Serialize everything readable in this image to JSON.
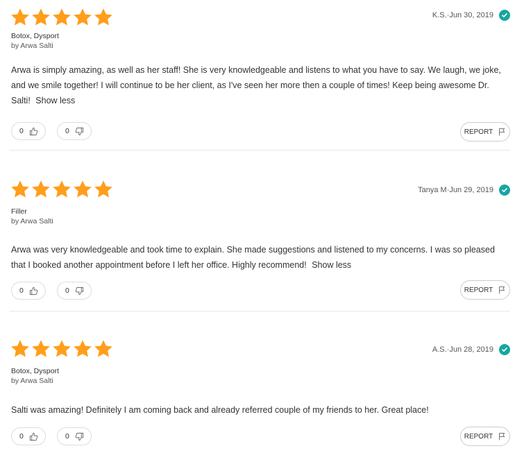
{
  "colors": {
    "star": "#FF9E1B",
    "verified": "#17a6a0",
    "divider": "#e6e6e6"
  },
  "reviews": [
    {
      "rating": 5,
      "author": "K.S.",
      "date": "Jun 30, 2019",
      "treatments": "Botox, Dysport",
      "by": "by Arwa Salti",
      "text": "Arwa is simply amazing, as well as her staff! She is very knowledgeable and listens to what you have to say. We laugh, we joke, and we smile together! I will continue to be her client, as I've seen her more then a couple of times! Keep being awesome Dr. Salti!",
      "show_less": "Show less",
      "helpful": "0",
      "unhelpful": "0",
      "report_label": "REPORT"
    },
    {
      "rating": 5,
      "author": "Tanya M",
      "date": "Jun 29, 2019",
      "treatments": "Filler",
      "by": "by Arwa Salti",
      "text": "Arwa was very knowledgeable and took time to explain. She made suggestions and listened to my concerns. I was so pleased that I booked another appointment before I left her office. Highly recommend!",
      "show_less": "Show less",
      "helpful": "0",
      "unhelpful": "0",
      "report_label": "REPORT"
    },
    {
      "rating": 5,
      "author": "A.S.",
      "date": "Jun 28, 2019",
      "treatments": "Botox, Dysport",
      "by": "by Arwa Salti",
      "text": "Salti was amazing! Definitely I am coming back and already referred couple of my friends to her. Great place!",
      "show_less": "",
      "helpful": "0",
      "unhelpful": "0",
      "report_label": "REPORT"
    }
  ],
  "separator": " · "
}
